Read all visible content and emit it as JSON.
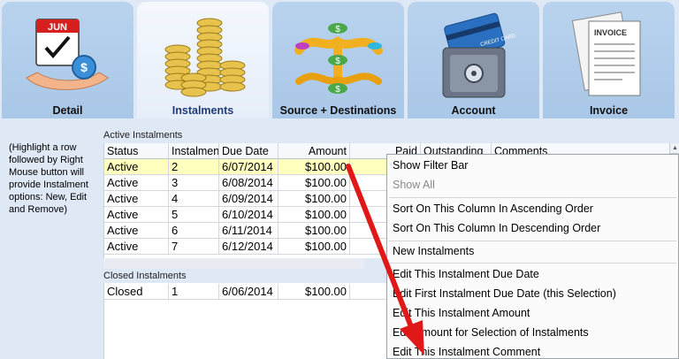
{
  "tabs": [
    {
      "label": "Detail",
      "icon": "calendar-hand-dollar-icon",
      "calendar_month": "JUN"
    },
    {
      "label": "Instalments",
      "icon": "coin-stacks-icon",
      "active": true
    },
    {
      "label": "Source + Destinations",
      "icon": "money-flow-icon"
    },
    {
      "label": "Account",
      "icon": "card-safe-icon",
      "card_text": "CREDIT CARD"
    },
    {
      "label": "Invoice",
      "icon": "invoice-documents-icon",
      "doc_text": "INVOICE"
    }
  ],
  "help_text": "(Highlight a row followed by Right Mouse button will provide Instalment options: New, Edit and Remove)",
  "active_section": {
    "title": "Active Instalments",
    "columns": [
      "Status",
      "Instalment",
      "Due Date",
      "Amount",
      "Paid",
      "Outstanding",
      "Comments"
    ],
    "rows": [
      {
        "status": "Active",
        "instalment": "2",
        "due": "6/07/2014",
        "amount": "$100.00"
      },
      {
        "status": "Active",
        "instalment": "3",
        "due": "6/08/2014",
        "amount": "$100.00"
      },
      {
        "status": "Active",
        "instalment": "4",
        "due": "6/09/2014",
        "amount": "$100.00"
      },
      {
        "status": "Active",
        "instalment": "5",
        "due": "6/10/2014",
        "amount": "$100.00"
      },
      {
        "status": "Active",
        "instalment": "6",
        "due": "6/11/2014",
        "amount": "$100.00"
      },
      {
        "status": "Active",
        "instalment": "7",
        "due": "6/12/2014",
        "amount": "$100.00"
      }
    ]
  },
  "closed_section": {
    "title": "Closed Instalments",
    "rows": [
      {
        "status": "Closed",
        "instalment": "1",
        "due": "6/06/2014",
        "amount": "$100.00"
      }
    ]
  },
  "context_menu": {
    "items": [
      {
        "label": "Show Filter Bar",
        "enabled": true
      },
      {
        "label": "Show All",
        "enabled": false
      },
      {
        "label": "Sort On This Column In Ascending Order",
        "enabled": true
      },
      {
        "label": "Sort On This Column In Descending Order",
        "enabled": true
      },
      {
        "label": "New Instalments",
        "enabled": true
      },
      {
        "label": "Edit This Instalment Due Date",
        "enabled": true
      },
      {
        "label": "Edit First Instalment Due Date (this Selection)",
        "enabled": true
      },
      {
        "label": "Edit This Instalment Amount",
        "enabled": true
      },
      {
        "label": "Edit Amount for Selection of Instalments",
        "enabled": true
      },
      {
        "label": "Edit This Instalment Comment",
        "enabled": true
      }
    ]
  },
  "colors": {
    "tab_inactive": "#a9c7e7",
    "tab_active": "#eef3fb",
    "selected_row": "#ffffbe",
    "arrow": "#e01818"
  }
}
